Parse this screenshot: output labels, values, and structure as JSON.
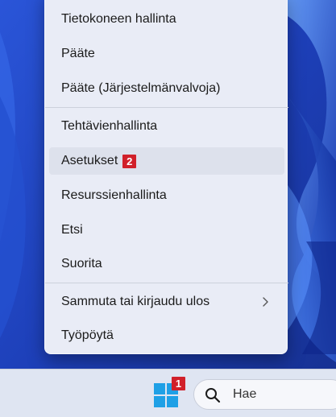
{
  "menu": {
    "items": [
      {
        "label": "Tietokoneen hallinta"
      },
      {
        "label": "Pääte"
      },
      {
        "label": "Pääte (Järjestelmänvalvoja)"
      },
      {
        "label": "Tehtävienhallinta"
      },
      {
        "label": "Asetukset",
        "badge": "2"
      },
      {
        "label": "Resurssienhallinta"
      },
      {
        "label": "Etsi"
      },
      {
        "label": "Suorita"
      },
      {
        "label": "Sammuta tai kirjaudu ulos"
      },
      {
        "label": "Työpöytä"
      }
    ]
  },
  "taskbar": {
    "start_badge": "1",
    "search_placeholder": "Hae"
  },
  "colors": {
    "wallpaper": "#1e3fbf",
    "menu_bg": "#e9ecf6",
    "badge": "#d1202a",
    "start_icon": "#1fa0e6"
  },
  "icons": {
    "start": "windows-start-icon",
    "search": "search-icon",
    "submenu": "chevron-right-icon"
  }
}
